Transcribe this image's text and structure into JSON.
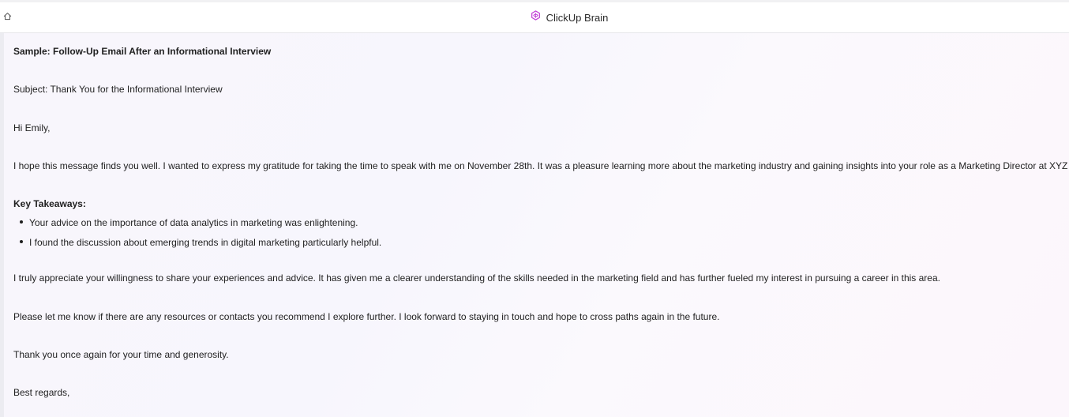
{
  "header": {
    "title": "ClickUp Brain",
    "home_icon": "home-icon",
    "brand_icon": "clickup-brain-icon",
    "accent_color": "#c13fd6"
  },
  "email": {
    "sample_title": "Sample: Follow-Up Email After an Informational Interview",
    "subject": "Subject: Thank You for the Informational Interview",
    "greeting": "Hi Emily,",
    "intro": "I hope this message finds you well. I wanted to express my gratitude for taking the time to speak with me on November 28th. It was a pleasure learning more about the marketing industry and gaining insights into your role as a Marketing Director at XYZ Corp.",
    "takeaways_heading": "Key Takeaways:",
    "takeaways": [
      "Your advice on the importance of data analytics in marketing was enlightening.",
      "I found the discussion about emerging trends in digital marketing particularly helpful."
    ],
    "appreciation": "I truly appreciate your willingness to share your experiences and advice. It has given me a clearer understanding of the skills needed in the marketing field and has further fueled my interest in pursuing a career in this area.",
    "request": "Please let me know if there are any resources or contacts you recommend I explore further. I look forward to staying in touch and hope to cross paths again in the future.",
    "thanks": "Thank you once again for your time and generosity.",
    "closing": "Best regards,"
  }
}
